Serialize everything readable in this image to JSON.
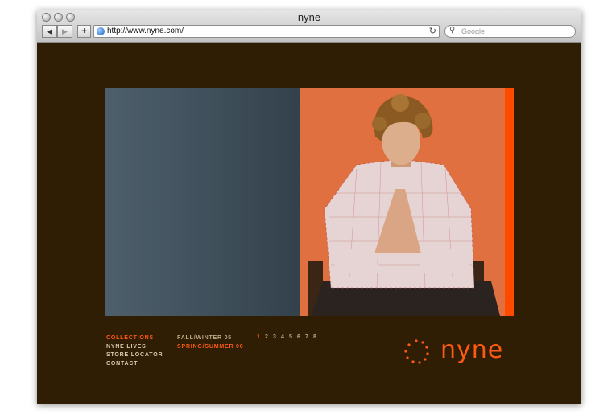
{
  "window": {
    "title": "nyne"
  },
  "toolbar": {
    "back_icon": "back-arrow-icon",
    "forward_icon": "forward-arrow-icon",
    "add_icon": "plus-icon",
    "address": "http://www.nyne.com/",
    "reload_icon": "reload-icon",
    "search_placeholder": "Google"
  },
  "site": {
    "nav": [
      {
        "label": "COLLECTIONS",
        "active": true
      },
      {
        "label": "NYNE LIVES",
        "active": false
      },
      {
        "label": "STORE LOCATOR",
        "active": false
      },
      {
        "label": "CONTACT",
        "active": false
      }
    ],
    "seasons": [
      {
        "label": "FALL/WINTER 05",
        "active": false
      },
      {
        "label": "SPRING/SUMMER 06",
        "active": true
      }
    ],
    "pages": [
      "1",
      "2",
      "3",
      "4",
      "5",
      "6",
      "7",
      "8"
    ],
    "active_page": "1",
    "logo_text": "nyne",
    "colors": {
      "background": "#2f1e04",
      "accent": "#ff5a12",
      "muted_text": "#d8c9b0",
      "hero_left": "#435460",
      "hero_right": "#e07040"
    }
  }
}
